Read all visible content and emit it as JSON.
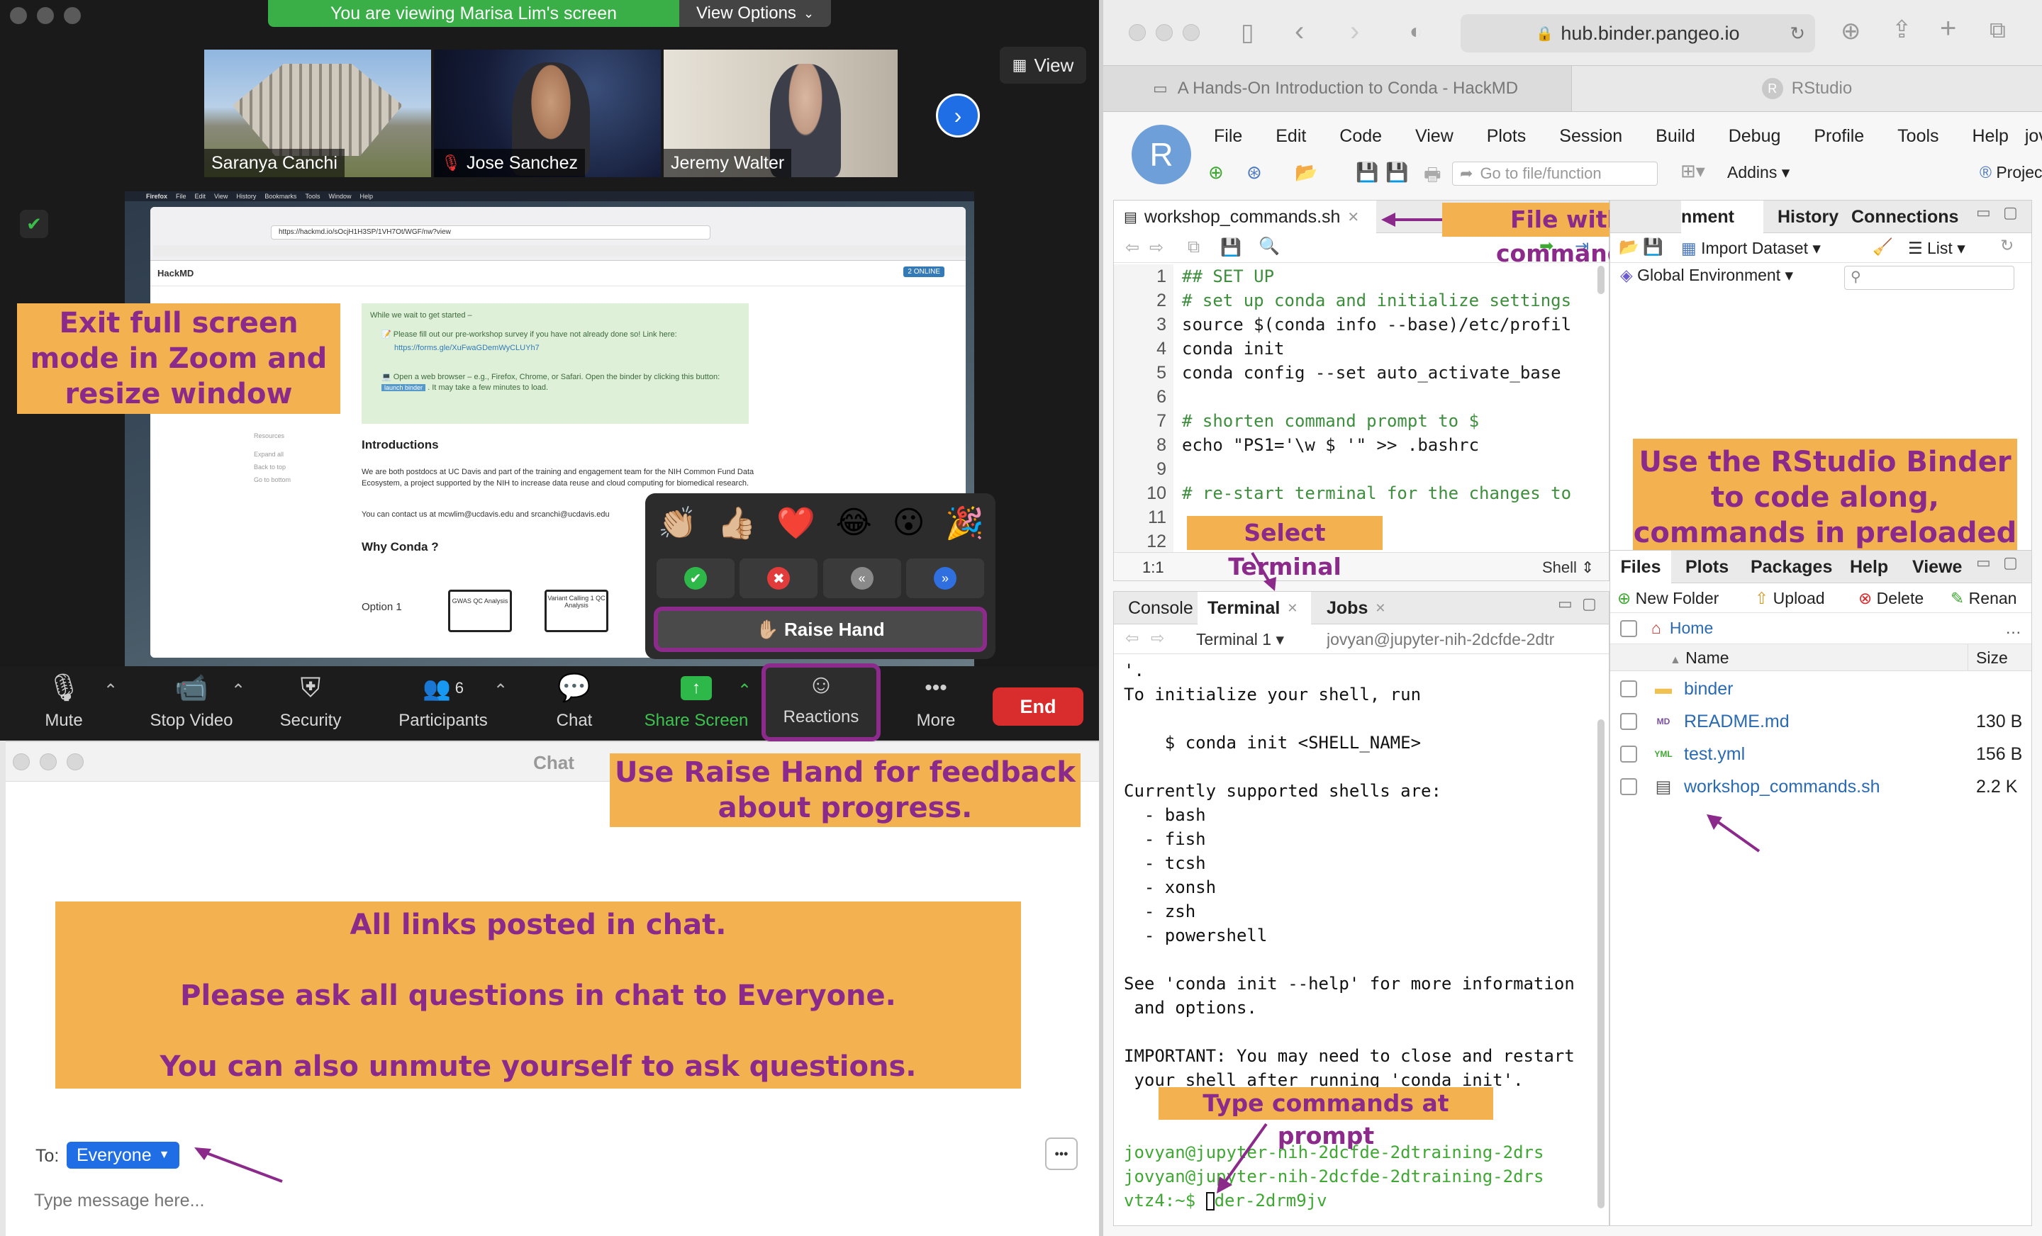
{
  "zoom": {
    "share_banner": "You are viewing Marisa Lim's screen",
    "view_options": "View Options",
    "view_button": "View",
    "participants_strip": [
      {
        "name": "Saranya Canchi",
        "muted": false
      },
      {
        "name": "Jose Sanchez",
        "muted": true
      },
      {
        "name": "Jeremy Walter",
        "muted": false
      }
    ],
    "toolbar": {
      "mute": "Mute",
      "stop_video": "Stop Video",
      "security": "Security",
      "participants": "Participants",
      "participants_count": "6",
      "chat": "Chat",
      "share_screen": "Share Screen",
      "reactions": "Reactions",
      "more": "More",
      "end": "End"
    },
    "reactions_popup": {
      "emojis": [
        "👏🏼",
        "👍🏼",
        "❤️",
        "😂",
        "😮",
        "🎉"
      ],
      "raise_hand": "✋🏼 Raise Hand"
    },
    "shared_screen": {
      "browser_menu": [
        "Firefox",
        "File",
        "Edit",
        "View",
        "History",
        "Bookmarks",
        "Tools",
        "Window",
        "Help"
      ],
      "url": "https://hackmd.io/sOcjH1H3SP/1VH7Ot/WGF/nw?view",
      "site_name": "HackMD",
      "online_badge": "2 ONLINE",
      "welcome_heading": "While we wait to get started –",
      "welcome_item_1": "📝 Please fill out our pre-workshop survey if you have not already done so! Link here:",
      "survey_link": "https://forms.gle/XuFwaGDemWyCLUYh7",
      "welcome_item_2": "💻 Open a web browser – e.g., Firefox, Chrome, or Safari. Open the binder by clicking this button:",
      "launch_badge": "launch binder",
      "welcome_item_2_tail": ". It may take a few minutes to load.",
      "intro_heading": "Introductions",
      "intro_text": "We are both postdocs at UC Davis and part of the training and engagement team for the NIH Common Fund Data Ecosystem, a project supported by the NIH to increase data reuse and cloud computing for biomedical research.",
      "contact_text": "You can contact us at mcwlim@ucdavis.edu and srcanchi@ucdavis.edu",
      "why_heading": "Why Conda ?",
      "option_label": "Option 1",
      "sidebar_links": [
        "Resources",
        "Expand all",
        "Back to top",
        "Go to bottom"
      ],
      "monitor_labels": [
        "GWAS QC Analysis",
        "Variant Calling 1 QC Analysis"
      ]
    },
    "chat": {
      "title": "Chat",
      "to_label": "To:",
      "recipient": "Everyone",
      "placeholder": "Type message here..."
    }
  },
  "annotations": {
    "exit_full_screen": "Exit full screen mode in Zoom and resize window",
    "raise_hand": "Use Raise Hand for feedback about progress.",
    "links_line1": "All links posted in chat.",
    "links_line2": "Please ask all questions in chat to Everyone.",
    "links_line3": "You can also unmute yourself to ask questions.",
    "file_with_commands": "File with commands",
    "rstudio_binder": "Use the RStudio Binder to code along, commands in preloaded file",
    "select_terminal": "Select Terminal",
    "type_commands": "Type commands at prompt"
  },
  "safari": {
    "address": "hub.binder.pangeo.io",
    "tabs": [
      "A Hands-On Introduction to Conda - HackMD",
      "RStudio"
    ]
  },
  "rstudio": {
    "logo_letter": "R",
    "menu": [
      "File",
      "Edit",
      "Code",
      "View",
      "Plots",
      "Session",
      "Build",
      "Debug",
      "Profile",
      "Tools",
      "Help"
    ],
    "user": "jovyan",
    "goto_placeholder": "Go to file/function",
    "addins": "Addins",
    "project": "Project: (N",
    "editor_tab": "workshop_commands.sh",
    "env_tabs": [
      "nment",
      "History",
      "Connections"
    ],
    "import_dataset": "Import Dataset",
    "list_view": "List",
    "global_env": "Global Environment",
    "code_lines": [
      "## SET UP",
      "# set up conda and initialize settings",
      "source $(conda info --base)/etc/profil",
      "conda init",
      "conda config --set auto_activate_base",
      "",
      "# shorten command prompt to $",
      "echo \"PS1='\\w $ '\" >> .bashrc",
      "",
      "# re-start terminal for the changes to",
      "",
      ""
    ],
    "cursor_pos": "1:1",
    "file_type": "Shell",
    "console_tabs": [
      "Console",
      "Terminal",
      "Jobs"
    ],
    "terminal_selector": "Terminal 1",
    "terminal_path": "jovyan@jupyter-nih-2dcfde-2dtr",
    "terminal_lines": [
      "'.",
      "To initialize your shell, run",
      "",
      "    $ conda init <SHELL_NAME>",
      "",
      "Currently supported shells are:",
      "  - bash",
      "  - fish",
      "  - tcsh",
      "  - xonsh",
      "  - zsh",
      "  - powershell",
      "",
      "See 'conda init --help' for more information",
      " and options.",
      "",
      "IMPORTANT: You may need to close and restart",
      " your shell after running 'conda init'."
    ],
    "prompt_lines": [
      "jovyan@jupyter-nih-2dcfde-2dtraining-2drs",
      "jovyan@jupyter-nih-2dcfde-2dtraining-2drs",
      "vtz4:~$ "
    ],
    "prompt_tail": "der-2drm9jv",
    "files_tabs": [
      "Files",
      "Plots",
      "Packages",
      "Help",
      "Viewe"
    ],
    "files_toolbar": [
      "New Folder",
      "Upload",
      "Delete",
      "Renan"
    ],
    "home_label": "Home",
    "col_name": "Name",
    "col_size": "Size",
    "files": [
      {
        "name": "binder",
        "size": "",
        "type": "folder"
      },
      {
        "name": "README.md",
        "size": "130 B",
        "type": "md"
      },
      {
        "name": "test.yml",
        "size": "156 B",
        "type": "yml"
      },
      {
        "name": "workshop_commands.sh",
        "size": "2.2 K",
        "type": "sh"
      }
    ]
  },
  "colors": {
    "annotation_bg": "#f3b14f",
    "annotation_text": "#8b2a8b",
    "zoom_dark": "#1a1a1a",
    "end_red": "#d92c2c",
    "rstudio_blue": "#4a78c0",
    "terminal_green": "#3ea832"
  }
}
